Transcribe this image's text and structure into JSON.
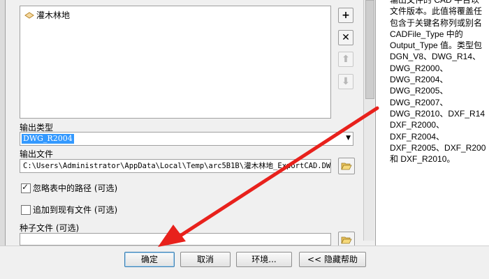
{
  "list": {
    "items": [
      {
        "label": "灌木林地",
        "icon": "layer-icon"
      }
    ]
  },
  "side_buttons": [
    {
      "name": "add-button",
      "glyph": "+",
      "icon": "plus-icon"
    },
    {
      "name": "remove-button",
      "glyph": "✕",
      "icon": "close-icon"
    },
    {
      "name": "move-up-button",
      "glyph": "⬆",
      "icon": "arrow-up-icon"
    },
    {
      "name": "move-down-button",
      "glyph": "⬇",
      "icon": "arrow-down-icon"
    }
  ],
  "output_type": {
    "label": "输出类型",
    "value": "DWG_R2004"
  },
  "output_file": {
    "label": "输出文件",
    "value": "C:\\Users\\Administrator\\AppData\\Local\\Temp\\arc5B1B\\灌木林地_ExportCAD.DWG"
  },
  "options": {
    "ignore_paths": {
      "label": "忽略表中的路径 (可选)",
      "checked": true
    },
    "append": {
      "label": "追加到现有文件 (可选)",
      "checked": false
    }
  },
  "seed_file": {
    "label": "种子文件 (可选)",
    "value": ""
  },
  "help": {
    "lines": [
      "输出文件的 CAD 平台以",
      "文件版本。此值将覆盖任",
      "包含于关键名称列或别名",
      "CADFile_Type 中的",
      "Output_Type 值。类型包",
      "DGN_V8、DWG_R14、",
      "DWG_R2000、",
      "DWG_R2004、",
      "DWG_R2005、",
      "DWG_R2007、",
      "DWG_R2010、DXF_R14",
      "DXF_R2000、",
      "DXF_R2004、",
      "DXF_R2005、DXF_R200",
      "和 DXF_R2010。"
    ]
  },
  "footer": {
    "ok": "确定",
    "cancel": "取消",
    "env": "环境...",
    "hide_help": "<< 隐藏帮助"
  },
  "colors": {
    "selection": "#3399ff",
    "arrow": "#e8211c"
  }
}
